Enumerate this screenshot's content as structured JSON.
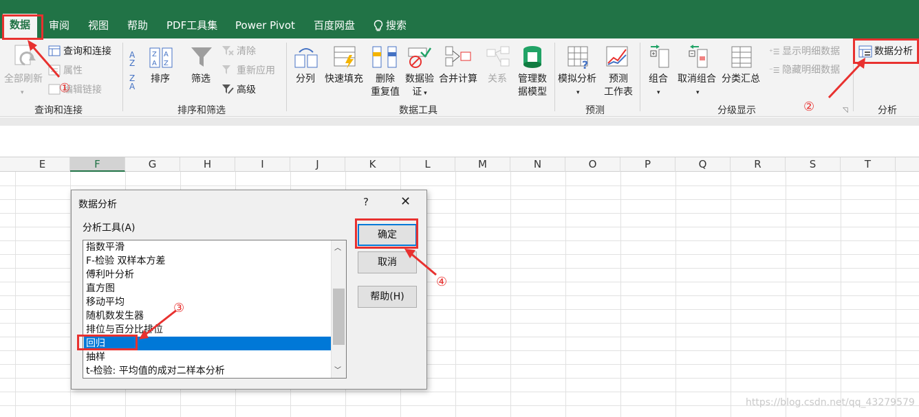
{
  "tabs": {
    "data": "数据",
    "review": "审阅",
    "view": "视图",
    "help": "帮助",
    "pdf": "PDF工具集",
    "powerpivot": "Power Pivot",
    "baidu": "百度网盘",
    "search": "搜索"
  },
  "ribbon": {
    "refresh_all": "全部刷新",
    "query_connect": "查询和连接",
    "properties": "属性",
    "edit_links": "编辑链接",
    "group_query": "查询和连接",
    "sort": "排序",
    "filter": "筛选",
    "clear": "清除",
    "reapply": "重新应用",
    "advanced": "高级",
    "group_sort": "排序和筛选",
    "text_to_columns": "分列",
    "flash_fill": "快速填充",
    "remove_dup_1": "删除",
    "remove_dup_2": "重复值",
    "data_validation_1": "数据验",
    "data_validation_2": "证",
    "consolidate": "合并计算",
    "relationships": "关系",
    "manage_model_1": "管理数",
    "manage_model_2": "据模型",
    "group_data_tools": "数据工具",
    "what_if": "模拟分析",
    "forecast_1": "预测",
    "forecast_2": "工作表",
    "group_forecast": "预测",
    "group_btn": "组合",
    "ungroup": "取消组合",
    "subtotal": "分类汇总",
    "show_detail": "显示明细数据",
    "hide_detail": "隐藏明细数据",
    "group_outline": "分级显示",
    "data_analysis": "数据分析",
    "group_analysis": "分析"
  },
  "columns": [
    "E",
    "F",
    "G",
    "H",
    "I",
    "J",
    "K",
    "L",
    "M",
    "N",
    "O",
    "P",
    "Q",
    "R",
    "S",
    "T"
  ],
  "selected_column": "F",
  "dialog": {
    "title": "数据分析",
    "help": "?",
    "close": "✕",
    "tools_label": "分析工具(A)",
    "items": [
      "指数平滑",
      "F-检验 双样本方差",
      "傅利叶分析",
      "直方图",
      "移动平均",
      "随机数发生器",
      "排位与百分比排位",
      "回归",
      "抽样",
      "t-检验: 平均值的成对二样本分析"
    ],
    "selected_item": "回归",
    "ok": "确定",
    "cancel": "取消",
    "help_button": "帮助(H)"
  },
  "annotations": [
    "①",
    "②",
    "③",
    "④"
  ],
  "watermark": "https://blog.csdn.net/qq_43279579",
  "colors": {
    "excel_green": "#217346",
    "annotation_red": "#e8312f",
    "selection_blue": "#0078d7"
  }
}
